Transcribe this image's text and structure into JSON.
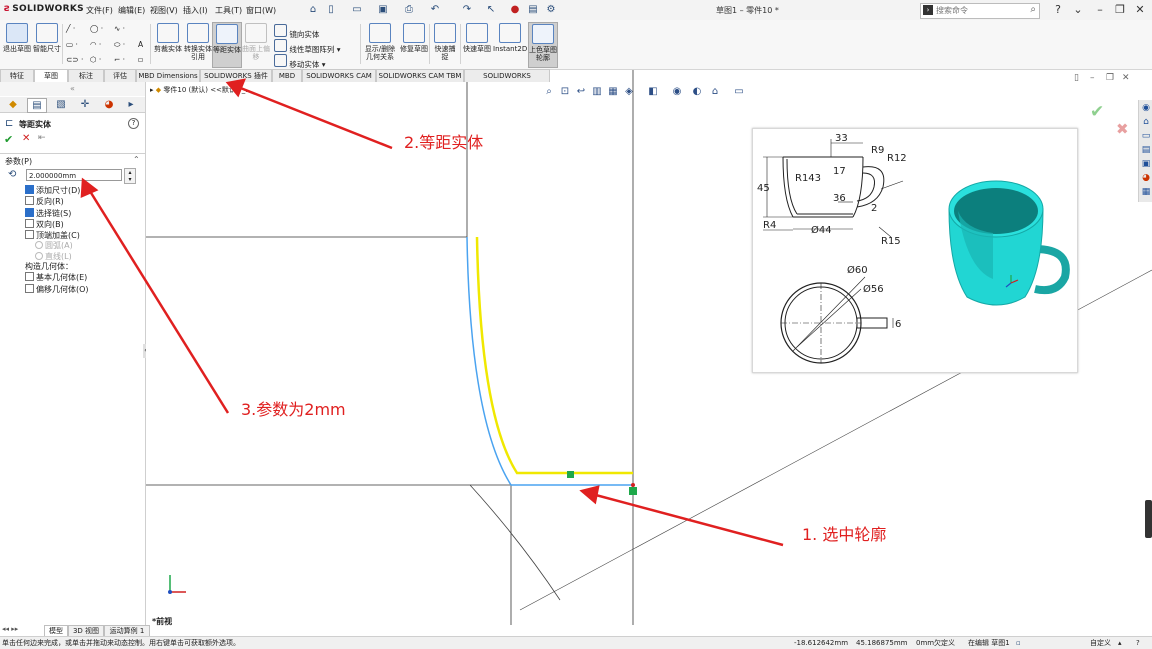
{
  "app": {
    "logo_text": "SOLIDWORKS",
    "document_title": "草图1 – 零件10 *",
    "menu": [
      "文件(F)",
      "编辑(E)",
      "视图(V)",
      "插入(I)",
      "工具(T)",
      "窗口(W)"
    ],
    "search_placeholder": "搜索命令"
  },
  "ribbon": {
    "exit_sketch": "退出草图",
    "smart_dimension": "智能尺寸",
    "convert_entities": "转换实体引用",
    "trim_entities": "剪裁实体",
    "offset_entities": "等距实体",
    "offset_on_surface": "曲面上偏移",
    "mirror_entities": "镜向实体",
    "linear_pattern": "线性草图阵列",
    "move_entities": "移动实体",
    "display_relations": "显示/删除几何关系",
    "repair_sketch": "修复草图",
    "quick_snaps": "快速捕捉",
    "rapid_sketch": "快速草图",
    "instant2d": "Instant2D",
    "shaded_contours": "上色草图轮廓"
  },
  "tabs": [
    "特征",
    "草图",
    "标注",
    "评估",
    "MBD Dimensions",
    "SOLIDWORKS 插件",
    "MBD",
    "SOLIDWORKS CAM",
    "SOLIDWORKS CAM TBM",
    "SOLIDWORKS Inspection"
  ],
  "property_manager": {
    "title": "等距实体",
    "help": "?",
    "params_header": "参数(P)",
    "offset_value": "2.000000mm",
    "options": [
      {
        "label": "添加尺寸(D)",
        "checked": true
      },
      {
        "label": "反向(R)",
        "checked": false
      },
      {
        "label": "选择链(S)",
        "checked": true
      },
      {
        "label": "双向(B)",
        "checked": false
      },
      {
        "label": "顶端加盖(C)",
        "checked": false
      }
    ],
    "cap_options": [
      "圆弧(A)",
      "直线(L)"
    ],
    "construction_label": "构造几何体：",
    "construction_options": [
      {
        "label": "基本几何体(E)",
        "checked": false
      },
      {
        "label": "偏移几何体(O)",
        "checked": false
      }
    ]
  },
  "feature_path": "零件10 (默认) <<默认>_...",
  "view_label": "*前视",
  "bottom_tabs": [
    "模型",
    "3D 视图",
    "运动算例 1"
  ],
  "status": {
    "message": "单击任何边来完成，或单击并拖动来动态控制。用右键单击可获取额外选项。",
    "x": "-18.612642mm",
    "y": "45.186875mm",
    "z": "0mm",
    "state": "欠定义",
    "editing": "在编辑 草图1",
    "custom": "自定义"
  },
  "annotations": {
    "step1": "1. 选中轮廓",
    "step2": "2.等距实体",
    "step3": "3.参数为2mm"
  },
  "drawing": {
    "dims": {
      "d33": "33",
      "d17": "17",
      "r9": "R9",
      "r12": "R12",
      "d45": "45",
      "r143": "R143",
      "d36": "36",
      "d2": "2",
      "r4": "R4",
      "phi44": "Ø44",
      "r15": "R15",
      "phi60": "Ø60",
      "phi56": "Ø56",
      "d6": "6"
    }
  },
  "colors": {
    "offset_line": "#f0e800",
    "selected_profile": "#4aa3f0",
    "annotation": "#e02020",
    "cup": "#21d6d3"
  }
}
